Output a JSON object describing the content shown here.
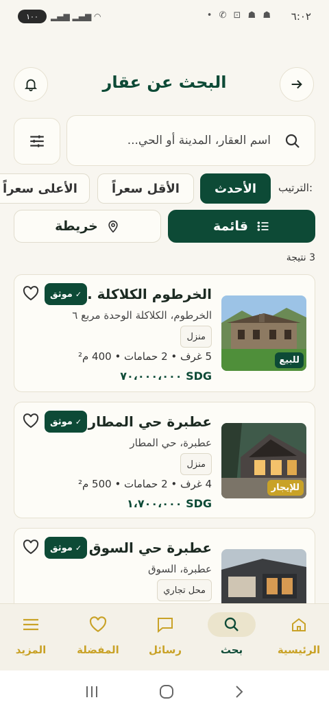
{
  "status_bar": {
    "time": "٦:٠٢",
    "battery": "١٠٠",
    "icons": "• ✆ ⊡ ☗ ☗"
  },
  "header": {
    "title": "البحث عن عقار"
  },
  "search": {
    "placeholder": "اسم العقار، المدينة أو الحي..."
  },
  "sort": {
    "label": "الترتيب:",
    "options": [
      "الأحدث",
      "الأقل سعراً",
      "الأعلى سعراً"
    ],
    "active": 0
  },
  "view": {
    "list_label": "قائمة",
    "map_label": "خريطة"
  },
  "results": {
    "count_text": "3 نتيجة"
  },
  "listings": [
    {
      "title": "الخرطوم الكلاكلة ...",
      "location": "الخرطوم، الكلاكلة الوحدة مربع ٦",
      "type": "منزل",
      "specs": "5 غرف • 2 حمامات • 400 م²",
      "price": "SDG ٧٠،٠٠٠،٠٠٠",
      "verified": "موثق",
      "status": "للبيع",
      "status_color": "#0d4a36"
    },
    {
      "title": "عطبرة حي المطار",
      "location": "عطبرة، حي المطار",
      "type": "منزل",
      "specs": "4 غرف • 2 حمامات • 500 م²",
      "price": "SDG ١،٧٠٠،٠٠٠",
      "verified": "موثق",
      "status": "للإيجار",
      "status_color": "#c9a227"
    },
    {
      "title": "عطبرة حي السوق",
      "location": "عطبرة، السوق",
      "type": "محل تجاري",
      "specs": "",
      "price": "",
      "verified": "موثق",
      "status": "",
      "status_color": "#c9a227"
    }
  ],
  "bottom_nav": {
    "items": [
      {
        "label": "الرئيسية",
        "icon": "home-icon"
      },
      {
        "label": "بحث",
        "icon": "search-icon"
      },
      {
        "label": "رسائل",
        "icon": "message-icon"
      },
      {
        "label": "المفضلة",
        "icon": "heart-icon"
      },
      {
        "label": "المزيد",
        "icon": "menu-icon"
      }
    ],
    "active": 1
  },
  "colors": {
    "primary": "#0d4a36",
    "accent": "#c9a227",
    "background": "#f8f6f0"
  }
}
